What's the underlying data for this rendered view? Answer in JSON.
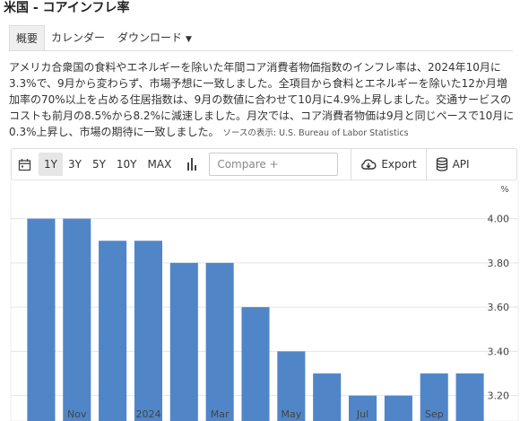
{
  "page": {
    "title": "米国 - コアインフレ率",
    "tabs": [
      "概要",
      "カレンダー",
      "ダウンロード"
    ],
    "description": "アメリカ合衆国の食料やエネルギーを除いた年間コア消費者物価指数のインフレ率は、2024年10月に3.3%で、9月から変わらず、市場予想に一致しました。全項目から食料とエネルギーを除いた12か月増加率の70%以上を占める住居指数は、9月の数値に合わせて10月に4.9%上昇しました。交通サービスのコストも前月の8.5%から8.2%に減速しました。月次では、コア消費者物価は9月と同じペースで10月に0.3%上昇し、市場の期待に一致しました。",
    "source": "ソースの表示: U.S. Bureau of Labor Statistics"
  },
  "toolbar": {
    "ranges": [
      "1Y",
      "3Y",
      "5Y",
      "10Y",
      "MAX"
    ],
    "active_range": "1Y",
    "compare_placeholder": "Compare +",
    "export_label": "Export",
    "api_label": "API",
    "icons": [
      "calendar-icon",
      "bar-chart-icon",
      "download-cloud-icon",
      "database-icon"
    ]
  },
  "chart_data": {
    "type": "bar",
    "unit": "%",
    "x_tick_labels": [
      "Nov",
      "2024",
      "Mar",
      "May",
      "Jul",
      "Sep"
    ],
    "x_tick_indices": [
      1,
      3,
      5,
      7,
      9,
      11
    ],
    "values": [
      4.0,
      4.0,
      3.9,
      3.9,
      3.8,
      3.8,
      3.6,
      3.4,
      3.3,
      3.2,
      3.2,
      3.3,
      3.3
    ],
    "y_ticks": [
      3.2,
      3.4,
      3.6,
      3.8,
      4.0
    ],
    "y_tick_labels": [
      "3.20",
      "3.40",
      "3.60",
      "3.80",
      "4.00"
    ],
    "ylim": [
      3.15,
      4.12
    ],
    "bar_color": "#5086c8",
    "grid": true
  }
}
